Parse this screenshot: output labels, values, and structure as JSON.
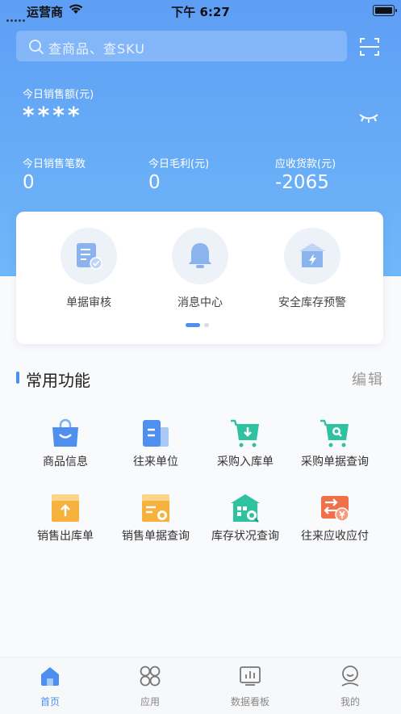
{
  "status_bar": {
    "carrier": "运营商",
    "time": "下午 6:27"
  },
  "search": {
    "placeholder": "查商品、查SKU"
  },
  "sales": {
    "label": "今日销售额(元)",
    "value": "****"
  },
  "metrics": [
    {
      "label": "今日销售笔数",
      "value": "0"
    },
    {
      "label": "今日毛利(元)",
      "value": "0"
    },
    {
      "label": "应收货款(元)",
      "value": "-2065"
    }
  ],
  "quick_actions": [
    {
      "label": "单据审核",
      "icon": "document-check-icon"
    },
    {
      "label": "消息中心",
      "icon": "bell-icon"
    },
    {
      "label": "安全库存预警",
      "icon": "warehouse-alert-icon"
    }
  ],
  "section": {
    "title": "常用功能",
    "edit_label": "编辑"
  },
  "functions": [
    {
      "label": "商品信息",
      "icon": "shopping-bag-icon",
      "color": "#4f8ff0"
    },
    {
      "label": "往来单位",
      "icon": "building-icon",
      "color": "#4f8ff0"
    },
    {
      "label": "采购入库单",
      "icon": "cart-in-icon",
      "color": "#2fc2a0"
    },
    {
      "label": "采购单据查询",
      "icon": "cart-search-icon",
      "color": "#2fc2a0"
    },
    {
      "label": "销售出库单",
      "icon": "box-out-icon",
      "color": "#f6b23c"
    },
    {
      "label": "销售单据查询",
      "icon": "box-search-icon",
      "color": "#f6b23c"
    },
    {
      "label": "库存状况查询",
      "icon": "warehouse-search-icon",
      "color": "#2fc2a0"
    },
    {
      "label": "往来应收应付",
      "icon": "transfer-money-icon",
      "color": "#f0704a"
    }
  ],
  "tabbar": [
    {
      "label": "首页",
      "icon": "home-icon",
      "active": true
    },
    {
      "label": "应用",
      "icon": "apps-icon",
      "active": false
    },
    {
      "label": "数据看板",
      "icon": "dashboard-icon",
      "active": false
    },
    {
      "label": "我的",
      "icon": "profile-icon",
      "active": false
    }
  ],
  "colors": {
    "primary": "#4d8ff0",
    "hero_top": "#5e9ef5",
    "green": "#2fc2a0",
    "orange": "#f6b23c",
    "red": "#f0704a"
  }
}
